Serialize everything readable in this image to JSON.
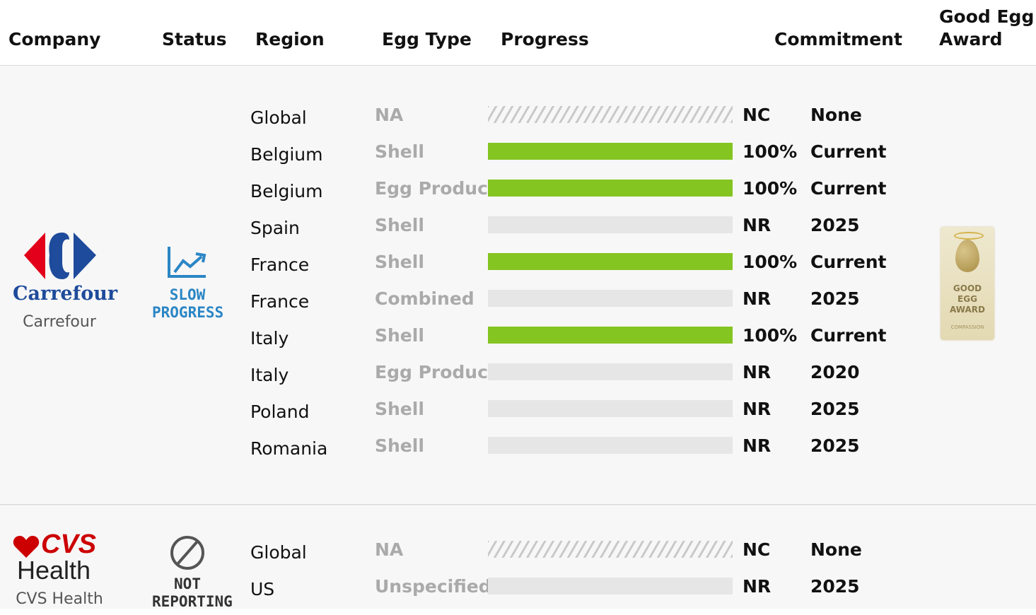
{
  "columns": {
    "company": "Company",
    "status": "Status",
    "region": "Region",
    "egg_type": "Egg Type",
    "progress": "Progress",
    "commitment": "Commitment",
    "award_line1": "Good Egg",
    "award_line2": "Award"
  },
  "companies": [
    {
      "logo_text": "Carrefour",
      "name": "Carrefour",
      "status_icon": "trend-up-icon",
      "status_line1": "SLOW",
      "status_line2": "PROGRESS",
      "award": {
        "line1": "GOOD",
        "line2": "EGG",
        "line3": "AWARD",
        "footer": "COMPASSION"
      },
      "rows": [
        {
          "region": "Global",
          "egg_type": "NA",
          "progress": null,
          "label": "NC",
          "commitment": "None"
        },
        {
          "region": "Belgium",
          "egg_type": "Shell",
          "progress": 100,
          "label": "100%",
          "commitment": "Current"
        },
        {
          "region": "Belgium",
          "egg_type": "Egg Product",
          "progress": 100,
          "label": "100%",
          "commitment": "Current"
        },
        {
          "region": "Spain",
          "egg_type": "Shell",
          "progress": 0,
          "label": "NR",
          "commitment": "2025"
        },
        {
          "region": "France",
          "egg_type": "Shell",
          "progress": 100,
          "label": "100%",
          "commitment": "Current"
        },
        {
          "region": "France",
          "egg_type": "Combined",
          "progress": 0,
          "label": "NR",
          "commitment": "2025"
        },
        {
          "region": "Italy",
          "egg_type": "Shell",
          "progress": 100,
          "label": "100%",
          "commitment": "Current"
        },
        {
          "region": "Italy",
          "egg_type": "Egg Product",
          "progress": 0,
          "label": "NR",
          "commitment": "2020"
        },
        {
          "region": "Poland",
          "egg_type": "Shell",
          "progress": 0,
          "label": "NR",
          "commitment": "2025"
        },
        {
          "region": "Romania",
          "egg_type": "Shell",
          "progress": 0,
          "label": "NR",
          "commitment": "2025"
        }
      ]
    },
    {
      "logo_text_1": "CVS",
      "logo_text_2": "Health",
      "name": "CVS Health",
      "status_icon": "prohibited-icon",
      "status_line1": "NOT",
      "status_line2": "REPORTING",
      "rows": [
        {
          "region": "Global",
          "egg_type": "NA",
          "progress": null,
          "label": "NC",
          "commitment": "None"
        },
        {
          "region": "US",
          "egg_type": "Unspecified",
          "progress": 0,
          "label": "NR",
          "commitment": "2025"
        }
      ]
    }
  ],
  "colors": {
    "progress_fill": "#84c522",
    "progress_track": "#e6e6e6",
    "status_blue": "#2b86c5",
    "carrefour_red": "#e2001a",
    "carrefour_blue": "#1e4b9b",
    "cvs_red": "#cc0000"
  }
}
